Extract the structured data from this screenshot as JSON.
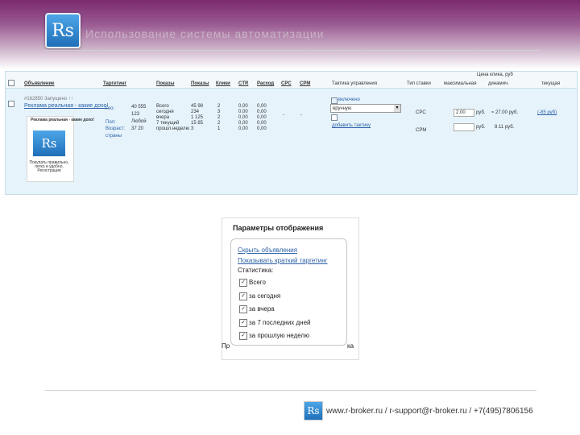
{
  "header": {
    "logo_text": "Rs",
    "title": "Использование системы автоматизации"
  },
  "table": {
    "top_note": "Цена клика, руб",
    "headers": {
      "ads": "Объявление",
      "targeting": "Таргетинг",
      "shows": "Показы",
      "clicks": "Показы",
      "bids": "Клики",
      "ctr": "CTR",
      "spend": "Расход",
      "cpc": "CPC",
      "cpm": "CPM",
      "tactics": "Тактика управления",
      "bid_type": "Тип ставки",
      "max": "максимальная",
      "dynamic": "динамич.",
      "current": "текущая"
    },
    "ad": {
      "meta": "#162850  Запущено  ↑↑",
      "link": "Реклама реальная - какие дохо!",
      "box_title": "Реклама реальная - какие дохо!",
      "box_logo": "Rs",
      "box_desc": "Покупать правильно, легко и удобно. Регистрация"
    },
    "targeting": {
      "geo": "Гео:",
      "sex": "Пол:",
      "age": "Возраст:",
      "countries": "страны",
      "v1": "40 555",
      "v2": "123",
      "v3": "Любой",
      "v4": "37 20"
    },
    "periods": [
      "Всего",
      "сегодня",
      "вчера",
      "7 текущий",
      "прошл.неделю"
    ],
    "shows": [
      "45 98",
      "234",
      "1 125",
      "15 85",
      "3"
    ],
    "clicks": [
      "2",
      "3",
      "2",
      "2",
      "1"
    ],
    "ctr": [
      "0,00",
      "0,00",
      "0,00",
      "0,00",
      "0,00"
    ],
    "spend": [
      "0,00",
      "0,00",
      "0,00",
      "0,00",
      "0,00"
    ],
    "cpc": "-",
    "cpm": "-",
    "tactics": {
      "enabled": "включено",
      "select_value": "вручную",
      "add_tactic": "добавить тактику"
    },
    "bid_types": [
      "CPC",
      "CPM"
    ],
    "max_value": "2.00",
    "rub": "руб.",
    "dynamic": [
      "≈ 27.00 руб.",
      "8.11 руб."
    ],
    "current_link": "(-85 руб)"
  },
  "panel": {
    "title": "Параметры отображения",
    "hide_ads": "Скрыть объявления",
    "show_targeting": "Показывать краткий таргетинг",
    "stats_label": "Статистика:",
    "options": [
      "Всего",
      "за сегодня",
      "за вчера",
      "за 7 последних дней",
      "за прошлую неделю"
    ],
    "bottom_left": "Пр",
    "bottom_right": "ка"
  },
  "footer": {
    "logo_text": "Rs",
    "contact": "www.r-broker.ru / r-support@r-broker.ru / +7(495)7806156"
  }
}
